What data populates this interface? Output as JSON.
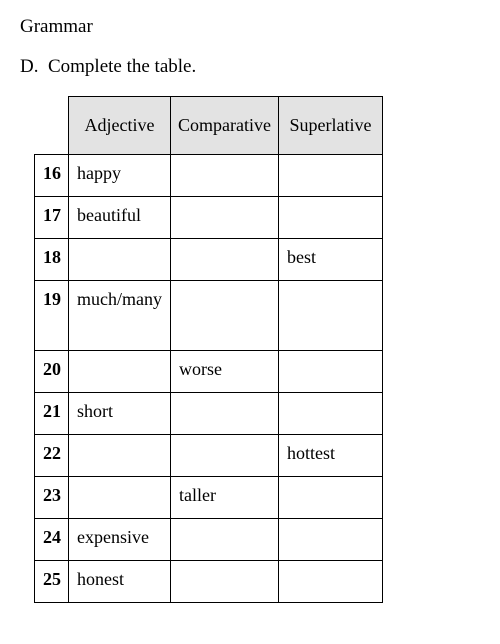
{
  "title": "Grammar",
  "instruction": "D.  Complete the table.",
  "headers": {
    "adjective": "Adjective",
    "comparative": "Comparative",
    "superlative": "Superlative"
  },
  "rows": [
    {
      "num": "16",
      "adjective": "happy",
      "comparative": "",
      "superlative": ""
    },
    {
      "num": "17",
      "adjective": "beautiful",
      "comparative": "",
      "superlative": ""
    },
    {
      "num": "18",
      "adjective": "",
      "comparative": "",
      "superlative": "best"
    },
    {
      "num": "19",
      "adjective": "much/many",
      "comparative": "",
      "superlative": ""
    },
    {
      "num": "20",
      "adjective": "",
      "comparative": "worse",
      "superlative": ""
    },
    {
      "num": "21",
      "adjective": "short",
      "comparative": "",
      "superlative": ""
    },
    {
      "num": "22",
      "adjective": "",
      "comparative": "",
      "superlative": "hottest"
    },
    {
      "num": "23",
      "adjective": "",
      "comparative": "taller",
      "superlative": ""
    },
    {
      "num": "24",
      "adjective": "expensive",
      "comparative": "",
      "superlative": ""
    },
    {
      "num": "25",
      "adjective": "honest",
      "comparative": "",
      "superlative": ""
    }
  ]
}
